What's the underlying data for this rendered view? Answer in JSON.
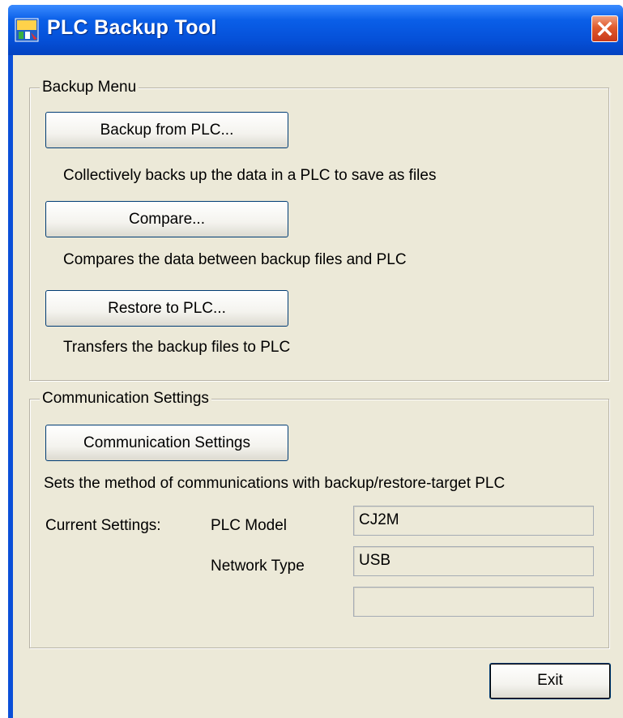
{
  "window": {
    "title": "PLC Backup Tool"
  },
  "backup_menu": {
    "legend": "Backup Menu",
    "backup_button": "Backup from PLC...",
    "backup_desc": "Collectively backs up the data in a PLC to save as files",
    "compare_button": "Compare...",
    "compare_desc": "Compares the data between backup files and PLC",
    "restore_button": "Restore to PLC...",
    "restore_desc": "Transfers the backup files to PLC"
  },
  "comm_settings": {
    "legend": "Communication Settings",
    "button": "Communication Settings",
    "desc": "Sets the method of communications with backup/restore-target PLC",
    "current_label": "Current Settings:",
    "plc_model_label": "PLC Model",
    "plc_model_value": "CJ2M",
    "network_type_label": "Network Type",
    "network_type_value": "USB",
    "extra_value": ""
  },
  "footer": {
    "exit_button": "Exit"
  }
}
